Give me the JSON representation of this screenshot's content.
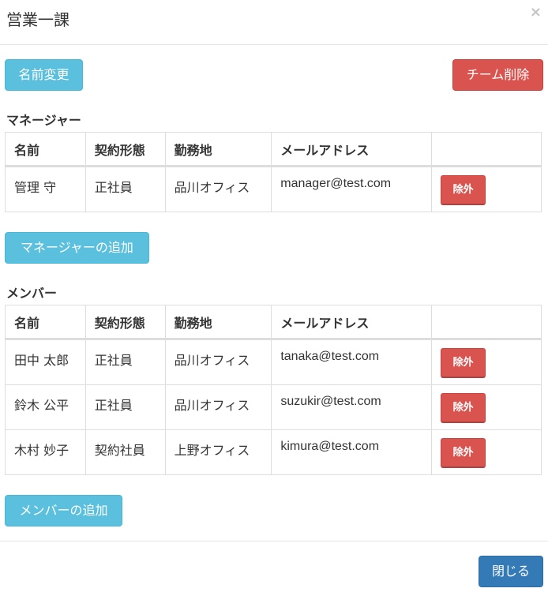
{
  "modal": {
    "title": "営業一課",
    "close_glyph": "×"
  },
  "actions": {
    "rename_label": "名前変更",
    "delete_team_label": "チーム削除",
    "add_manager_label": "マネージャーの追加",
    "add_member_label": "メンバーの追加",
    "close_label": "閉じる"
  },
  "table_headers": [
    "名前",
    "契約形態",
    "勤務地",
    "メールアドレス",
    ""
  ],
  "managers": {
    "heading": "マネージャー",
    "rows": [
      {
        "name": "管理 守",
        "contract": "正社員",
        "location": "品川オフィス",
        "email": "manager@test.com",
        "remove_label": "除外"
      }
    ]
  },
  "members": {
    "heading": "メンバー",
    "rows": [
      {
        "name": "田中 太郎",
        "contract": "正社員",
        "location": "品川オフィス",
        "email": "tanaka@test.com",
        "remove_label": "除外"
      },
      {
        "name": "鈴木 公平",
        "contract": "正社員",
        "location": "品川オフィス",
        "email": "suzukir@test.com",
        "remove_label": "除外"
      },
      {
        "name": "木村 妙子",
        "contract": "契約社員",
        "location": "上野オフィス",
        "email": "kimura@test.com",
        "remove_label": "除外"
      }
    ]
  },
  "colors": {
    "info": "#5bc0de",
    "danger": "#d9534f",
    "primary": "#337ab7"
  }
}
